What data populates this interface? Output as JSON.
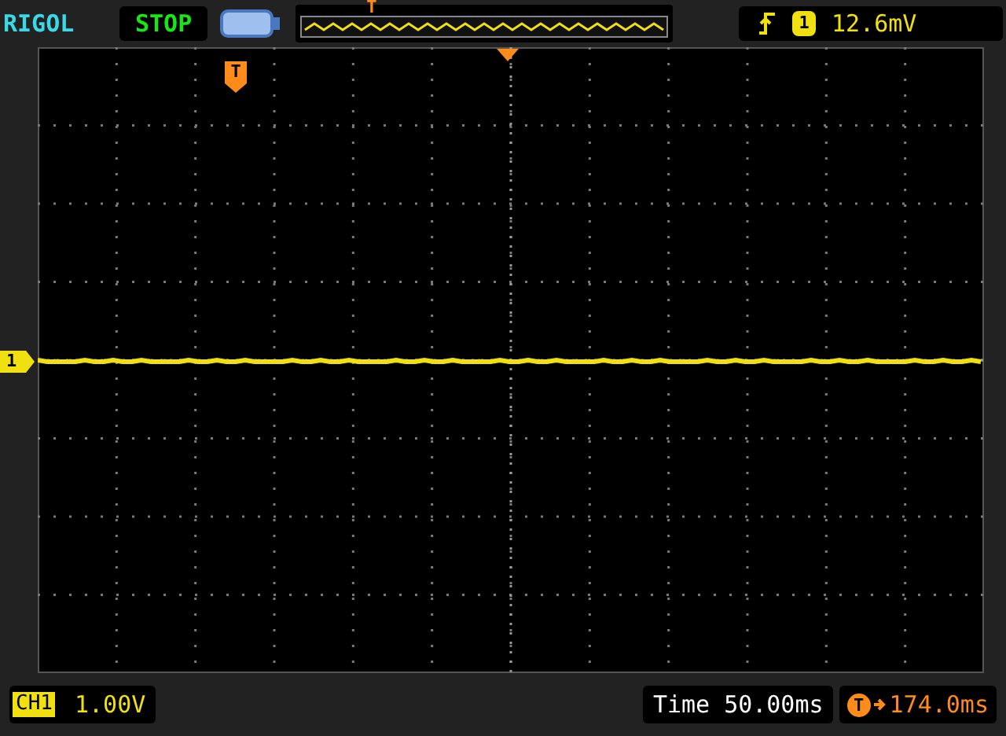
{
  "brand": "RIGOL",
  "run_state": "STOP",
  "memory_marker": "T",
  "trigger": {
    "channel": "1",
    "level": "12.6mV"
  },
  "grid": {
    "trigger_marker": "T",
    "channel_marker": "1"
  },
  "channel": {
    "label": "CH1",
    "scale": "1.00V"
  },
  "timebase": {
    "label": "Time",
    "value": "50.00ms"
  },
  "delay": {
    "marker": "T",
    "value": "174.0ms"
  }
}
